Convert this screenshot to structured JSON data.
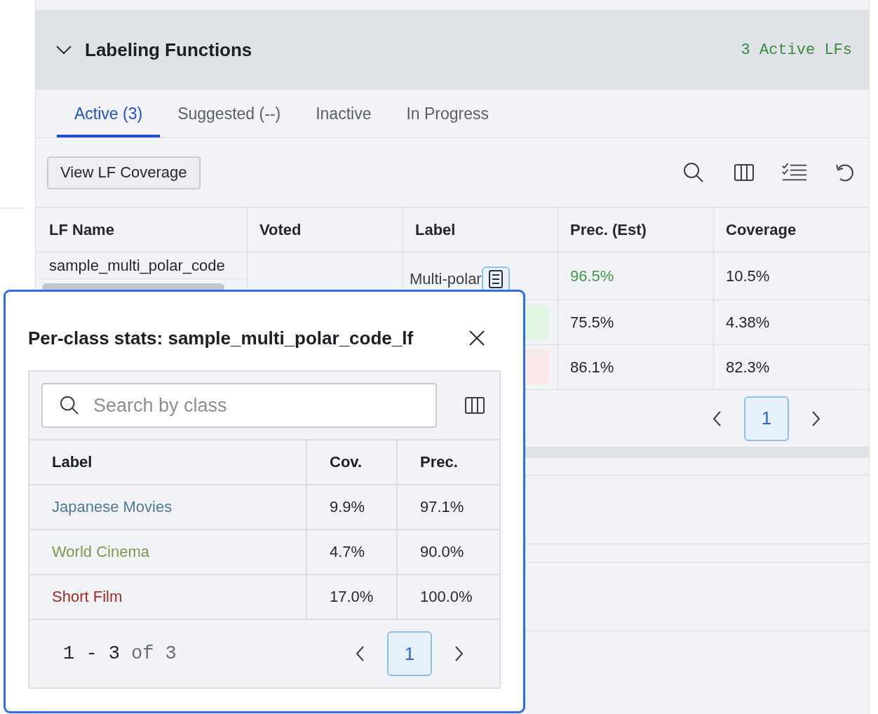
{
  "section": {
    "title": "Labeling Functions",
    "expanded": true,
    "summary": "3 Active LFs"
  },
  "tabs": [
    {
      "label": "Active (3)",
      "selected": true
    },
    {
      "label": "Suggested (--)",
      "selected": false
    },
    {
      "label": "Inactive",
      "selected": false
    },
    {
      "label": "In Progress",
      "selected": false
    }
  ],
  "toolbar": {
    "coverage_button": "View LF Coverage"
  },
  "table": {
    "columns": [
      "LF Name",
      "Voted",
      "Label",
      "Prec. (Est)",
      "Coverage"
    ],
    "rows": [
      {
        "name": "sample_multi_polar_code",
        "label": "Multi-polar",
        "precision": {
          "value": "96.5%",
          "color": "#3f9a45"
        },
        "coverage": "10.5%"
      },
      {
        "color": "#e3f5e3",
        "precision": {
          "value": "75.5%",
          "color": "#24272c"
        },
        "coverage": "4.38%"
      },
      {
        "color": "#fbe9e9",
        "precision": {
          "value": "86.1%",
          "color": "#24272c"
        },
        "coverage": "82.3%"
      }
    ],
    "page": "1"
  },
  "popover": {
    "title": "Per-class stats: sample_multi_polar_code_lf",
    "search_placeholder": "Search by class",
    "columns": [
      "Label",
      "Cov.",
      "Prec."
    ],
    "rows": [
      {
        "label": "Japanese Movies",
        "color": "#4e7a96",
        "coverage": "9.9%",
        "precision": "97.1%"
      },
      {
        "label": "World Cinema",
        "color": "#7d9a4c",
        "coverage": "4.7%",
        "precision": "90.0%"
      },
      {
        "label": "Short Film",
        "color": "#a32a24",
        "coverage": "17.0%",
        "precision": "100.0%"
      }
    ],
    "range": "1 - 3",
    "of": "of 3",
    "page": "1"
  }
}
